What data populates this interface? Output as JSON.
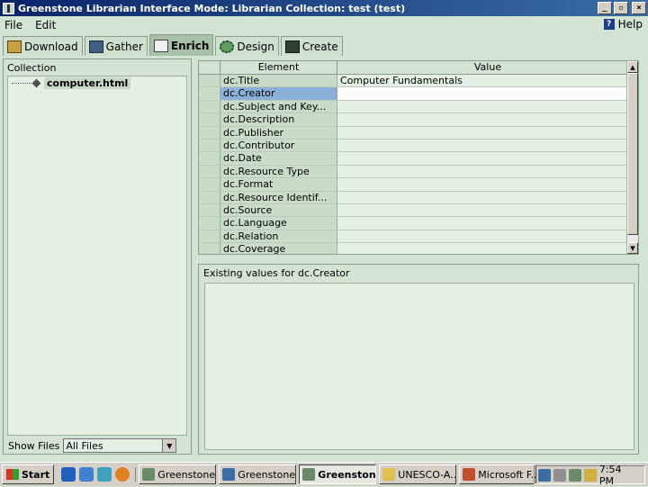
{
  "window": {
    "title": "Greenstone Librarian Interface  Mode: Librarian  Collection: test (test)"
  },
  "menu": {
    "file": "File",
    "edit": "Edit",
    "help": "Help"
  },
  "tabs": [
    {
      "label": "Download",
      "icon": "download-icon"
    },
    {
      "label": "Gather",
      "icon": "gather-icon"
    },
    {
      "label": "Enrich",
      "icon": "enrich-icon",
      "active": true
    },
    {
      "label": "Design",
      "icon": "design-icon"
    },
    {
      "label": "Create",
      "icon": "create-icon"
    }
  ],
  "collection": {
    "header": "Collection",
    "items": [
      "computer.html"
    ],
    "show_files_label": "Show Files",
    "show_files_value": "All Files"
  },
  "metadata": {
    "col_element": "Element",
    "col_value": "Value",
    "rows": [
      {
        "element": "dc.Title",
        "value": "Computer Fundamentals"
      },
      {
        "element": "dc.Creator",
        "value": ""
      },
      {
        "element": "dc.Subject and Key...",
        "value": ""
      },
      {
        "element": "dc.Description",
        "value": ""
      },
      {
        "element": "dc.Publisher",
        "value": ""
      },
      {
        "element": "dc.Contributor",
        "value": ""
      },
      {
        "element": "dc.Date",
        "value": ""
      },
      {
        "element": "dc.Resource Type",
        "value": ""
      },
      {
        "element": "dc.Format",
        "value": ""
      },
      {
        "element": "dc.Resource Identif...",
        "value": ""
      },
      {
        "element": "dc.Source",
        "value": ""
      },
      {
        "element": "dc.Language",
        "value": ""
      },
      {
        "element": "dc.Relation",
        "value": ""
      },
      {
        "element": "dc.Coverage",
        "value": ""
      }
    ],
    "selected_index": 1
  },
  "existing": {
    "header": "Existing values for dc.Creator"
  },
  "taskbar": {
    "start": "Start",
    "tasks": [
      {
        "label": "Greenstone ...",
        "color": "#6a8a6a"
      },
      {
        "label": "Greenstone...",
        "color": "#3a6ea5"
      },
      {
        "label": "Greenston...",
        "color": "#6a8a6a",
        "active": true
      },
      {
        "label": "UNESCO-A...",
        "color": "#e0c050"
      },
      {
        "label": "Microsoft F...",
        "color": "#c05030"
      }
    ],
    "clock": "7:54 PM"
  }
}
